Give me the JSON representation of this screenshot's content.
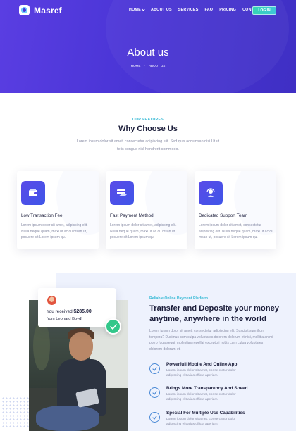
{
  "brand": {
    "name": "Masref"
  },
  "nav": {
    "items": [
      {
        "label": "HOME",
        "dropdown": true
      },
      {
        "label": "ABOUT US",
        "dropdown": false
      },
      {
        "label": "SERVICES",
        "dropdown": false
      },
      {
        "label": "FAQ",
        "dropdown": false
      },
      {
        "label": "PRICING",
        "dropdown": false
      },
      {
        "label": "CONTACT",
        "dropdown": false
      }
    ],
    "login_label": "LOG IN"
  },
  "hero": {
    "title": "About us",
    "breadcrumb": [
      "HOME",
      "ABOUT US"
    ]
  },
  "why": {
    "eyebrow": "OUR FEATURES",
    "title": "Why Choose Us",
    "description": "Lorem ipsum dolor sit amet, consectetur adipiscing elit. Sed quis accumsan nisi Ut ut felis congue nisl hendrerit commodo."
  },
  "cards": [
    {
      "icon": "wallet-icon",
      "title": "Low Transaction Fee",
      "text": "Lorem ipsum dolor sit amet, adipiscing elit. Nulla neque quam, maxi ut ac cu msan ut, posuere sit Lorem ipsum qu."
    },
    {
      "icon": "payment-card-icon",
      "title": "Fast Payment Method",
      "text": "Lorem ipsum dolor sit amet, adipiscing elit. Nulla neque quam, maxi ut ac cu msan ut, posuere sit Lorem ipsum qu."
    },
    {
      "icon": "support-headset-icon",
      "title": "Dedicated Support Team",
      "text": "Lorem ipsum dolor sit amet, consectetur adipiscing elit. Nulla neque quam, maxi ut ac cu msan ut, posuere sit Lorem ipsum qu."
    }
  ],
  "notification": {
    "line1_prefix": "You received",
    "amount": "$285.00",
    "line2": "from Leonard Boyd!"
  },
  "payment": {
    "eyebrow": "Reliable Online Payment Platform",
    "title": "Transfer and Deposite your money anytime, anywhere in the world",
    "description": "Lorem ipsum dolor sit amet, consectetur adipiscing elit. Suscipit sum illum tempora? Ducimus cum culpa voluptates dolorem dolorum et nisi, mollitia animi porro fuga sequi, molestias repellat excepturi nobis cum culpa voluptates dolorem dolorum et.",
    "features": [
      {
        "title": "Powerfull Mobile And Online App",
        "text": "Lorem ipsum dolor sit amet, conse ctetur dolor adipiscing elit alias officia aperiam."
      },
      {
        "title": "Brings More Transparency And Speed",
        "text": "Lorem ipsum dolor sit amet, conse ctetur dolor adipiscing elit alias officia aperiam."
      },
      {
        "title": "Special For Multiple Use Capabilities",
        "text": "Lorem ipsum dolor sit amet, conse ctetur dolor adipiscing elit alias officia aperiam."
      }
    ]
  },
  "colors": {
    "hero_start": "#5a3ee2",
    "hero_end": "#3f2fc4",
    "accent_teal": "#3bbbd6",
    "login_green": "#36d3b4",
    "success_green": "#32c78a",
    "icon_blue": "#4b8ad6"
  }
}
